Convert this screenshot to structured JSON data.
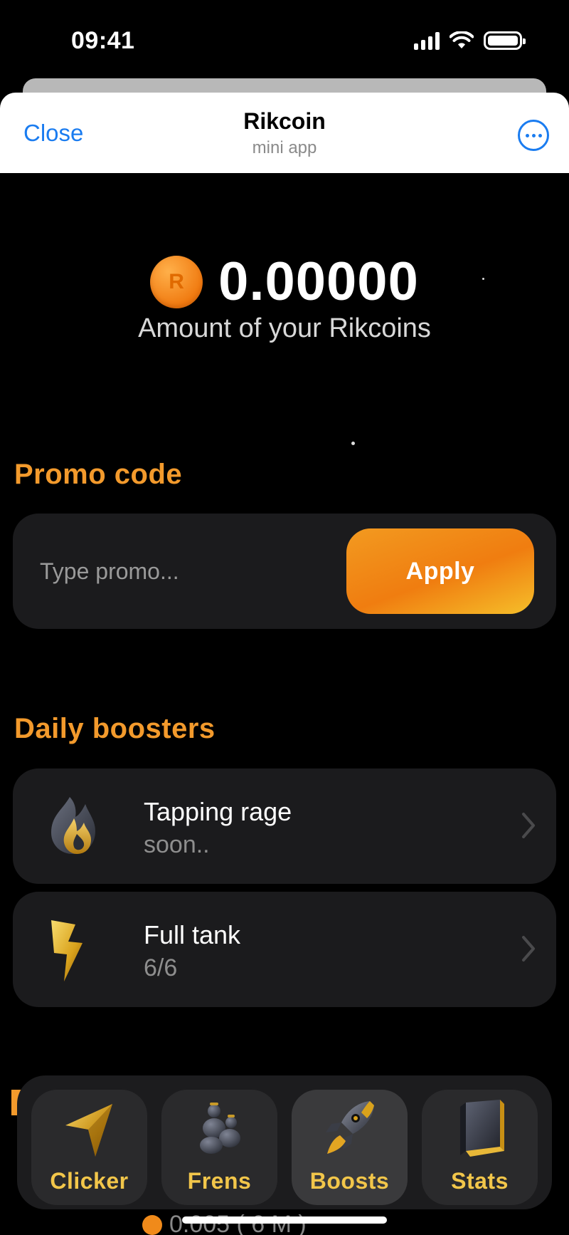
{
  "status_bar": {
    "time": "09:41"
  },
  "header": {
    "close_label": "Close",
    "title": "Rikcoin",
    "subtitle": "mini app"
  },
  "balance": {
    "coin_letter": "R",
    "value": "0.00000",
    "label": "Amount of your Rikcoins"
  },
  "promo": {
    "title": "Promo code",
    "placeholder": "Type promo...",
    "value": "",
    "apply_label": "Apply"
  },
  "daily_boosters": {
    "title": "Daily boosters",
    "items": [
      {
        "title": "Tapping rage",
        "subtitle": "soon..",
        "icon": "flame-icon"
      },
      {
        "title": "Full tank",
        "subtitle": "6/6",
        "icon": "lightning-icon"
      }
    ]
  },
  "partial_row": {
    "text": "0.005 ( 6 M )"
  },
  "nav": {
    "active": "Boosts",
    "items": [
      {
        "label": "Clicker",
        "icon": "cursor-icon"
      },
      {
        "label": "Frens",
        "icon": "friends-icon"
      },
      {
        "label": "Boosts",
        "icon": "rocket-icon"
      },
      {
        "label": "Stats",
        "icon": "book-icon"
      }
    ]
  },
  "colors": {
    "accent": "#f39a2c",
    "link": "#1a7cf0",
    "nav_label": "#f2c64a",
    "card_bg": "#1b1b1d"
  }
}
